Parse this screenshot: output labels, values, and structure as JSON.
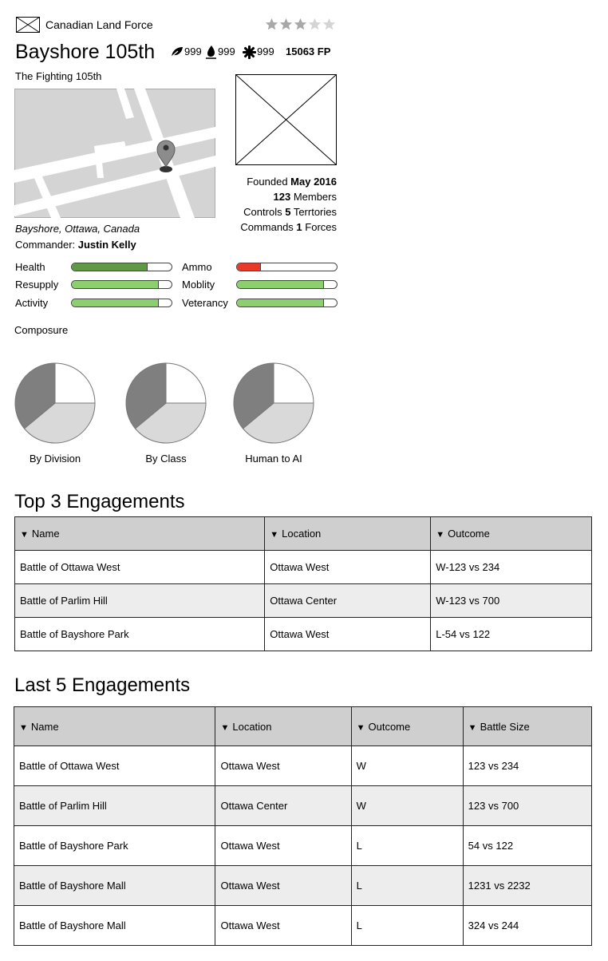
{
  "header": {
    "faction": "Canadian Land Force",
    "unit_name": "Bayshore 105th",
    "motto": "The Fighting 105th",
    "rating": 3,
    "rating_max": 5,
    "resources": [
      {
        "icon": "leaf-icon",
        "value": "999"
      },
      {
        "icon": "drop-icon",
        "value": "999"
      },
      {
        "icon": "gear-icon",
        "value": "999"
      }
    ],
    "fp": "15063 FP"
  },
  "location": "Bayshore, Ottawa, Canada",
  "commander": {
    "label": "Commander:",
    "name": "Justin Kelly"
  },
  "facts": [
    {
      "pre": "Founded ",
      "value": "May 2016",
      "post": ""
    },
    {
      "pre": "",
      "value": "123",
      "post": " Members"
    },
    {
      "pre": "Controls ",
      "value": "5",
      "post": " Terrtories"
    },
    {
      "pre": "Commands ",
      "value": "1",
      "post": " Forces"
    }
  ],
  "stats_left": [
    {
      "label": "Health",
      "fraction": 0.76,
      "color": "#5f9946"
    },
    {
      "label": "Resupply",
      "fraction": 0.87,
      "color": "#8ccf6e"
    },
    {
      "label": "Activity",
      "fraction": 0.87,
      "color": "#8ccf6e"
    }
  ],
  "stats_right": [
    {
      "label": "Ammo",
      "fraction": 0.24,
      "color": "#e8392b"
    },
    {
      "label": "Moblity",
      "fraction": 0.87,
      "color": "#8ccf6e"
    },
    {
      "label": "Veterancy",
      "fraction": 0.87,
      "color": "#8ccf6e"
    }
  ],
  "composure": {
    "title": "Composure",
    "charts": [
      {
        "label": "By Division",
        "slices": [
          0.25,
          0.39,
          0.36
        ]
      },
      {
        "label": "By Class",
        "slices": [
          0.25,
          0.39,
          0.36
        ]
      },
      {
        "label": "Human to AI",
        "slices": [
          0.25,
          0.39,
          0.36
        ]
      }
    ],
    "colors": [
      "#ffffff",
      "#d9d9d9",
      "#7f7f7f"
    ]
  },
  "top_engagements": {
    "title": "Top 3 Engagements",
    "columns": [
      "Name",
      "Location",
      "Outcome"
    ],
    "rows": [
      [
        "Battle of Ottawa West",
        "Ottawa West",
        "W-123 vs 234"
      ],
      [
        "Battle of Parlim Hill",
        "Ottawa Center",
        "W-123 vs 700"
      ],
      [
        "Battle of Bayshore Park",
        "Ottawa West",
        "L-54 vs 122"
      ]
    ]
  },
  "last_engagements": {
    "title": "Last 5 Engagements",
    "columns": [
      "Name",
      "Location",
      "Outcome",
      "Battle Size"
    ],
    "rows": [
      [
        "Battle of Ottawa West",
        "Ottawa West",
        "W",
        "123 vs 234"
      ],
      [
        "Battle of Parlim Hill",
        "Ottawa Center",
        "W",
        "123 vs 700"
      ],
      [
        "Battle of Bayshore Park",
        "Ottawa West",
        "L",
        "54 vs 122"
      ],
      [
        "Battle of Bayshore Mall",
        "Ottawa West",
        "L",
        "1231 vs 2232"
      ],
      [
        "Battle of Bayshore Mall",
        "Ottawa West",
        "L",
        "324 vs 244"
      ]
    ]
  }
}
